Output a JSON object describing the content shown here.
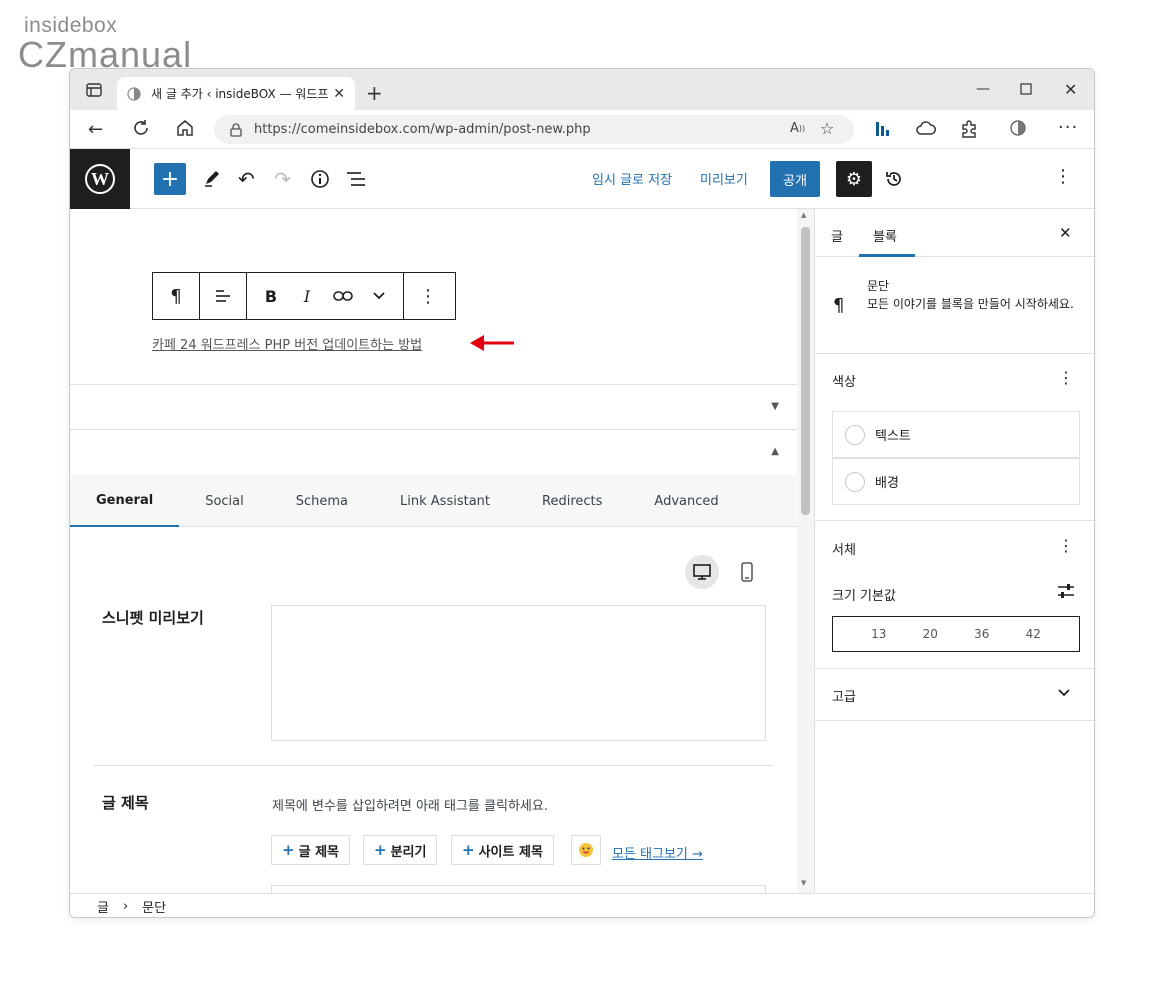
{
  "watermark": {
    "line1": "insidebox",
    "line2": "CZmanual"
  },
  "browser": {
    "tab_title": "새 글 추가 ‹ insideBOX — 워드프",
    "url": "https://comeinsidebox.com/wp-admin/post-new.php"
  },
  "wp_toolbar": {
    "save_draft": "임시 글로 저장",
    "preview": "미리보기",
    "publish": "공개"
  },
  "editor": {
    "paragraph_text": "카페 24 워드프레스 PHP 버전 업데이트하는 방법"
  },
  "seo_tabs": [
    "General",
    "Social",
    "Schema",
    "Link Assistant",
    "Redirects",
    "Advanced"
  ],
  "seo": {
    "snippet_label": "스니펫 미리보기",
    "title_label": "글 제목",
    "help_text": "제목에 변수를 삽입하려면 아래 태그를 클릭하세요.",
    "tag_buttons": [
      "글 제목",
      "분리기",
      "사이트 제목"
    ],
    "all_tags": "모든 태그보기 →"
  },
  "sidebar": {
    "tab_post": "글",
    "tab_block": "블록",
    "block_name": "문단",
    "block_desc": "모든 이야기를 블록을 만들어 시작하세요.",
    "color_title": "색상",
    "color_text": "텍스트",
    "color_bg": "배경",
    "typo_title": "서체",
    "size_label": "크기 기본값",
    "sizes": [
      "13",
      "20",
      "36",
      "42"
    ],
    "advanced": "고급"
  },
  "breadcrumb": {
    "root": "글",
    "current": "문단"
  },
  "colors": {
    "accent": "#2271b1",
    "dark": "#1e1e1e",
    "arrow": "#e3000f"
  }
}
